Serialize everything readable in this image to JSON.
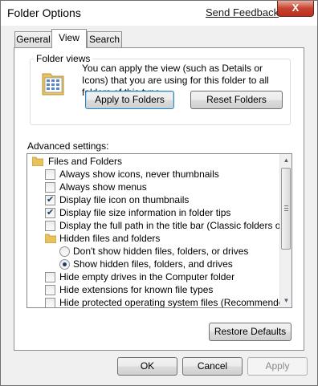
{
  "window": {
    "title": "Folder Options",
    "send_feedback": "Send Feedback",
    "close_label": "X"
  },
  "tabs": [
    {
      "label": "General",
      "active": false
    },
    {
      "label": "View",
      "active": true
    },
    {
      "label": "Search",
      "active": false
    }
  ],
  "folder_views": {
    "group_label": "Folder views",
    "description": "You can apply the view (such as Details or Icons) that you are using for this folder to all folders of this type.",
    "apply_button": "Apply to Folders",
    "reset_button": "Reset Folders"
  },
  "advanced": {
    "label": "Advanced settings:",
    "items": [
      {
        "type": "folder",
        "label": "Files and Folders"
      },
      {
        "type": "checkbox",
        "label": "Always show icons, never thumbnails",
        "checked": false
      },
      {
        "type": "checkbox",
        "label": "Always show menus",
        "checked": false
      },
      {
        "type": "checkbox",
        "label": "Display file icon on thumbnails",
        "checked": true
      },
      {
        "type": "checkbox",
        "label": "Display file size information in folder tips",
        "checked": true
      },
      {
        "type": "checkbox",
        "label": "Display the full path in the title bar (Classic folders only)",
        "checked": false
      },
      {
        "type": "folder",
        "label": "Hidden files and folders"
      },
      {
        "type": "radio",
        "label": "Don't show hidden files, folders, or drives",
        "checked": false
      },
      {
        "type": "radio",
        "label": "Show hidden files, folders, and drives",
        "checked": true
      },
      {
        "type": "checkbox",
        "label": "Hide empty drives in the Computer folder",
        "checked": false
      },
      {
        "type": "checkbox",
        "label": "Hide extensions for known file types",
        "checked": false
      },
      {
        "type": "checkbox",
        "label": "Hide protected operating system files (Recommended)",
        "checked": false
      }
    ],
    "restore_button": "Restore Defaults"
  },
  "footer": {
    "ok": "OK",
    "cancel": "Cancel",
    "apply": "Apply"
  }
}
